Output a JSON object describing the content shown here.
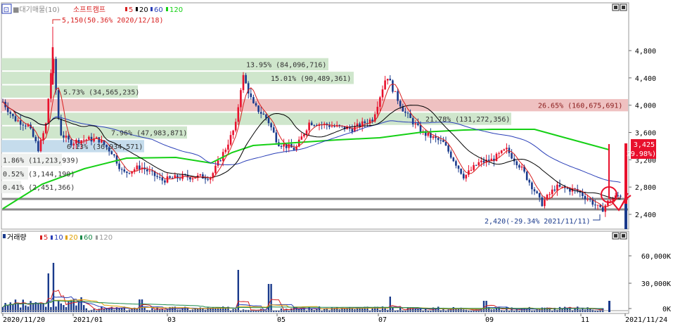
{
  "price_panel": {
    "legend": {
      "prefix": "■대기매물(10)",
      "stock": "소프트캠프",
      "ma5": "5",
      "ma20": "20",
      "ma60": "60",
      "ma120": "120"
    },
    "high_annotation": "5,150(50.36% 2020/12/18)",
    "low_annotation": "2,420(-29.34% 2021/11/11)",
    "current_price": "3,425",
    "current_change": "( 29.98%)",
    "colors": {
      "up": "#e8102c",
      "down": "#1a3a8c",
      "ma5": "#d81f1f",
      "ma20": "#000000",
      "ma60": "#2a3fb8",
      "ma120": "#15d015"
    }
  },
  "volume_panel": {
    "legend": {
      "title": "거래량",
      "ma5": "5",
      "ma10": "10",
      "ma20": "20",
      "ma60": "60",
      "ma120": "120"
    },
    "y_ticks": [
      "60,000K",
      "30,000K",
      "0K"
    ]
  },
  "chart_data": {
    "type": "candlestick",
    "y_ticks": [
      "4,800",
      "4,400",
      "4,000",
      "3,600",
      "3,200",
      "2,800",
      "2,400"
    ],
    "y_tick_values": [
      4800,
      4400,
      4000,
      3600,
      3200,
      2800,
      2400
    ],
    "ylim": [
      2200,
      5150
    ],
    "x_tick_labels": [
      "2020/11/20",
      "2021/01",
      "03",
      "05",
      "07",
      "09",
      "11",
      "2021/11/24"
    ],
    "volume_profile": [
      {
        "label": "13.95% (84,096,716)",
        "low": 4500,
        "high": 4700,
        "pct": 13.95
      },
      {
        "label": "15.01% (90,489,361)",
        "low": 4300,
        "high": 4500,
        "pct": 15.01
      },
      {
        "label": "5.73% (34,565,235)",
        "low": 4100,
        "high": 4300,
        "pct": 5.73
      },
      {
        "label": "26.65% (160,675,691)",
        "low": 3900,
        "high": 4100,
        "pct": 26.65
      },
      {
        "label": "21.78% (131,272,356)",
        "low": 3700,
        "high": 3900,
        "pct": 21.78
      },
      {
        "label": "7.96% (47,983,871)",
        "low": 3500,
        "high": 3700,
        "pct": 7.96
      },
      {
        "label": "6.13% (36,934,571)",
        "low": 3300,
        "high": 3500,
        "pct": 6.13
      },
      {
        "label": "1.86% (11,213,939)",
        "low": 3100,
        "high": 3300,
        "pct": 1.86
      },
      {
        "label": "0.52% (3,144,190)",
        "low": 2900,
        "high": 3100,
        "pct": 0.52
      },
      {
        "label": "0.41% (2,451,366)",
        "low": 2700,
        "high": 2900,
        "pct": 0.41
      }
    ],
    "ohlc_key_points": [
      {
        "date": "2020/11/20",
        "close": 4100
      },
      {
        "date": "2020/12/18",
        "high": 5150
      },
      {
        "date": "2021/01",
        "close": 3500
      },
      {
        "date": "2021/03",
        "close": 2900
      },
      {
        "date": "2021/05",
        "close": 4300
      },
      {
        "date": "2021/05",
        "close": 3450
      },
      {
        "date": "2021/07",
        "high": 4750
      },
      {
        "date": "2021/07",
        "close": 3900
      },
      {
        "date": "2021/09",
        "close": 3100
      },
      {
        "date": "2021/11/11",
        "low": 2420
      },
      {
        "date": "2021/11/24",
        "close": 3425
      }
    ]
  }
}
